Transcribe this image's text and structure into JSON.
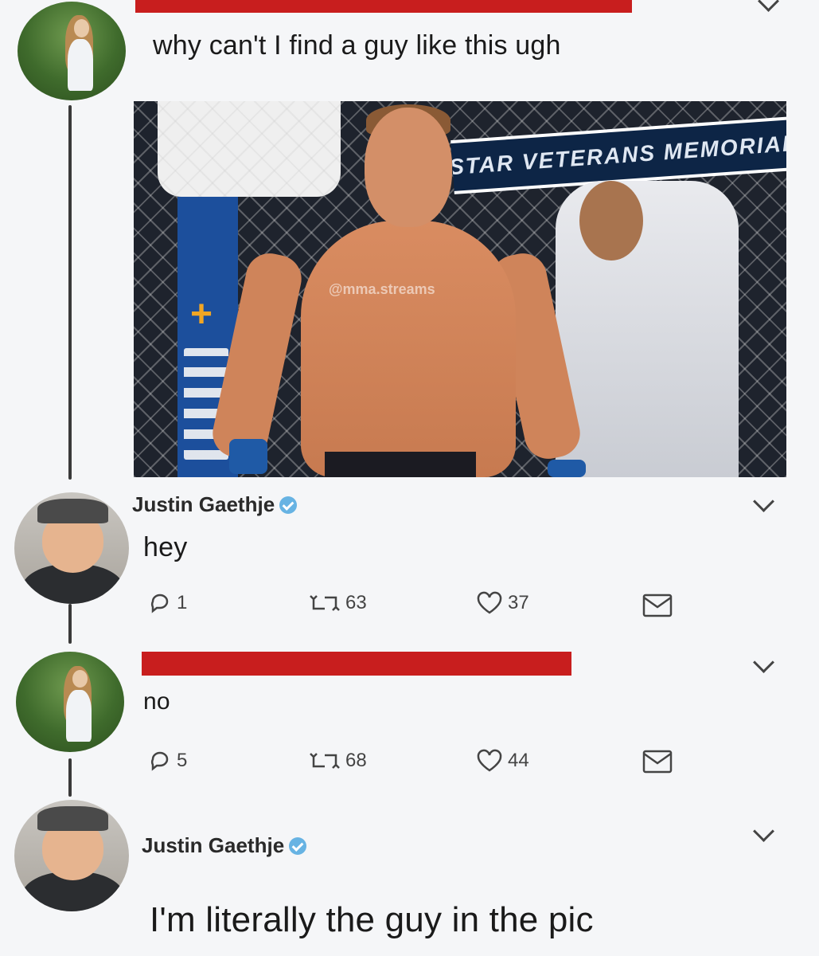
{
  "tweets": [
    {
      "text": "why can't I find a guy like this ugh",
      "media": {
        "banner_text": "STAR VETERANS MEMORIAL",
        "watermark": "@mma.streams"
      }
    },
    {
      "author": "Justin Gaethje",
      "text": "hey",
      "actions": {
        "replies": "1",
        "retweets": "63",
        "likes": "37"
      }
    },
    {
      "text": "no",
      "actions": {
        "replies": "5",
        "retweets": "68",
        "likes": "44"
      }
    },
    {
      "author": "Justin Gaethje",
      "text": "I'm literally the guy in the pic"
    }
  ],
  "colors": {
    "redaction": "#c81e1e",
    "verified": "#67b3e3",
    "background": "#f5f6f8"
  },
  "icons": [
    "reply-icon",
    "retweet-icon",
    "like-icon",
    "dm-icon",
    "chevron-down-icon",
    "verified-badge-icon"
  ]
}
